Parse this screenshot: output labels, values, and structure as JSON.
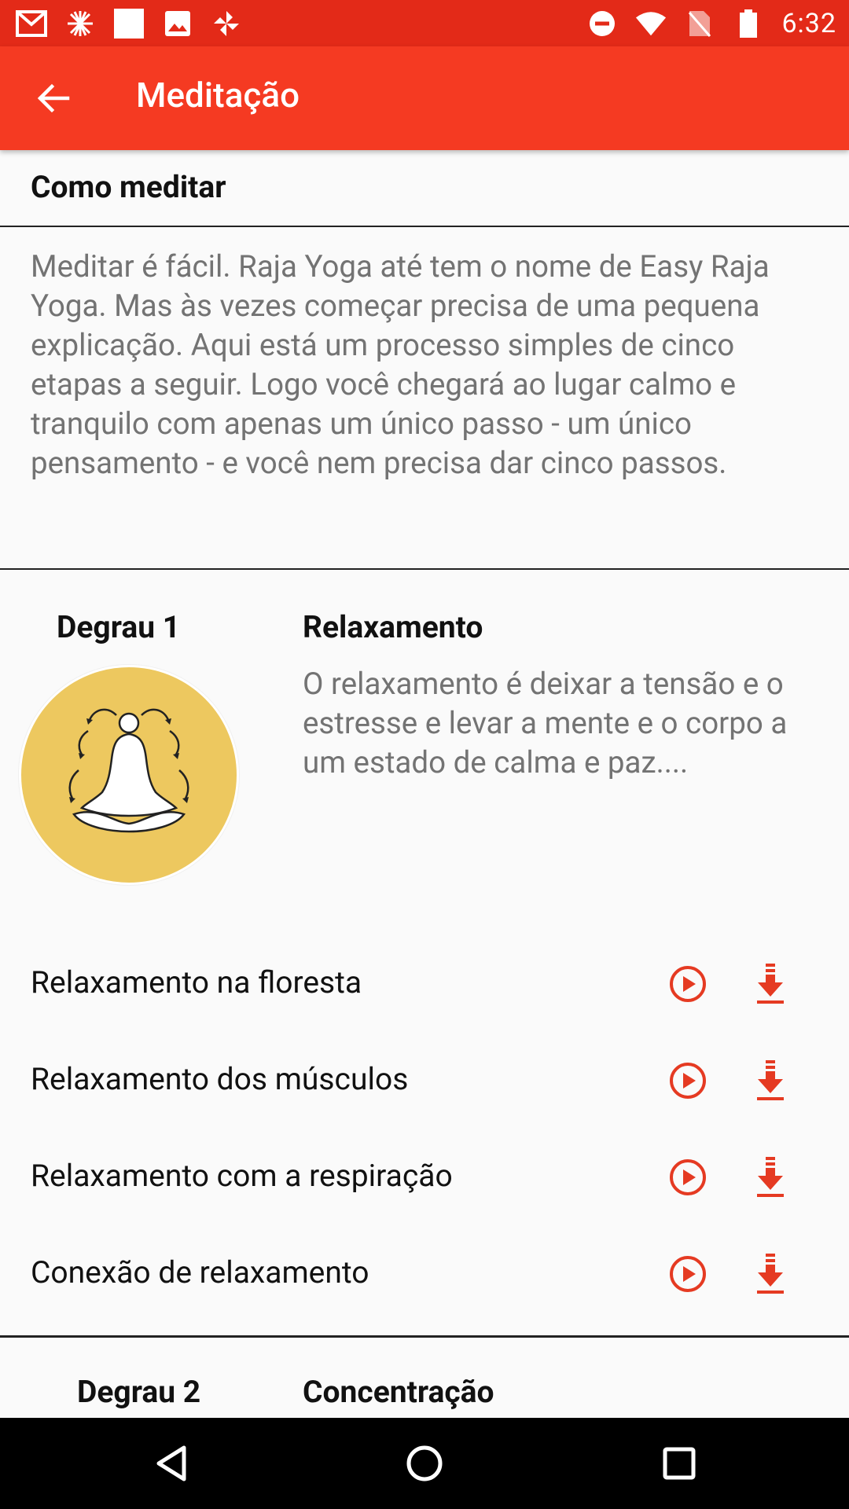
{
  "status_bar": {
    "time": "6:32",
    "left_icons": [
      "gmail-icon",
      "flower-icon",
      "square-icon",
      "image-icon",
      "pinwheel-icon"
    ],
    "right_icons": [
      "dnd-icon",
      "wifi-icon",
      "no-sim-icon",
      "battery-icon"
    ]
  },
  "app_bar": {
    "title": "Meditação",
    "back_icon": "arrow-back-icon",
    "color": "#f53a22"
  },
  "intro": {
    "title": "Como meditar",
    "text": "Meditar é fácil. Raja Yoga até tem o nome de Easy Raja Yoga. Mas às vezes começar precisa de uma pequena explicação. Aqui está um processo simples de cinco etapas a seguir. Logo você chegará ao lugar calmo e tranquilo com apenas um único passo - um único pensamento - e você nem precisa dar cinco passos."
  },
  "steps": [
    {
      "label": "Degrau 1",
      "title": "Relaxamento",
      "description": "O relaxamento é deixar a tensão e o estresse e levar a mente e o corpo a um estado de calma e paz....",
      "icon": "meditation-figure-icon",
      "badge_color": "#edc85f",
      "tracks": [
        {
          "name": "Relaxamento na floresta"
        },
        {
          "name": "Relaxamento dos músculos"
        },
        {
          "name": "Relaxamento com a respiração"
        },
        {
          "name": "Conexão de relaxamento"
        }
      ]
    },
    {
      "label": "Degrau 2",
      "title": "Concentração"
    }
  ],
  "accent_color": "#e53a22",
  "nav_bar": {
    "back": "back-triangle-icon",
    "home": "home-circle-icon",
    "recents": "recents-square-icon"
  }
}
